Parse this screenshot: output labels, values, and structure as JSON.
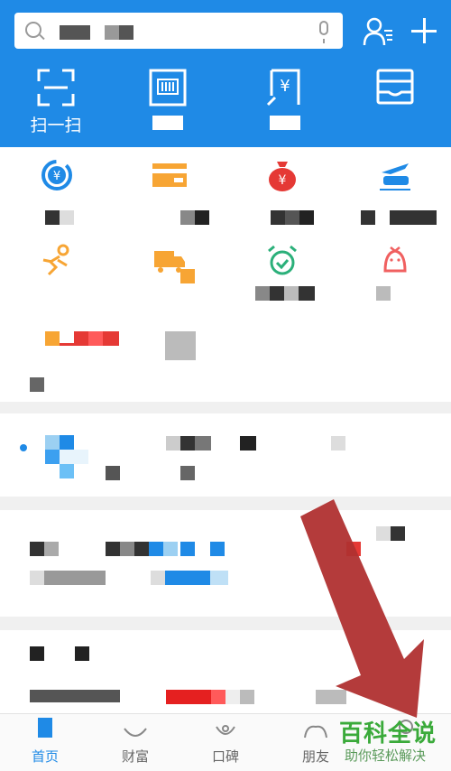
{
  "header": {
    "quick_actions": [
      {
        "label": "扫一扫",
        "icon": "scan-icon"
      },
      {
        "label": "",
        "icon": "barcode-icon"
      },
      {
        "label": "",
        "icon": "receipt-yuan-icon"
      },
      {
        "label": "",
        "icon": "card-wallet-icon"
      }
    ],
    "icons": [
      "search-icon",
      "microphone-icon",
      "contacts-icon",
      "plus-icon"
    ]
  },
  "grid": {
    "icons": [
      "yuan-refresh-icon",
      "card-icon",
      "money-bag-icon",
      "plane-train-icon",
      "runner-icon",
      "delivery-truck-icon",
      "alarm-clock-icon",
      "bird-icon"
    ]
  },
  "tabs": [
    {
      "label": "首页",
      "icon": "home-icon",
      "active": true
    },
    {
      "label": "财富",
      "icon": "wealth-icon",
      "active": false
    },
    {
      "label": "口碑",
      "icon": "koubei-icon",
      "active": false
    },
    {
      "label": "朋友",
      "icon": "friends-icon",
      "active": false
    },
    {
      "label": "",
      "icon": "me-icon",
      "active": false
    }
  ],
  "watermark": {
    "title": "百科全说",
    "subtitle": "助你轻松解决"
  },
  "colors": {
    "brand_blue": "#1f8ae6",
    "orange": "#f7a534",
    "red": "#e53935",
    "green": "#3aaa3a",
    "arrow_red": "#b03030"
  }
}
